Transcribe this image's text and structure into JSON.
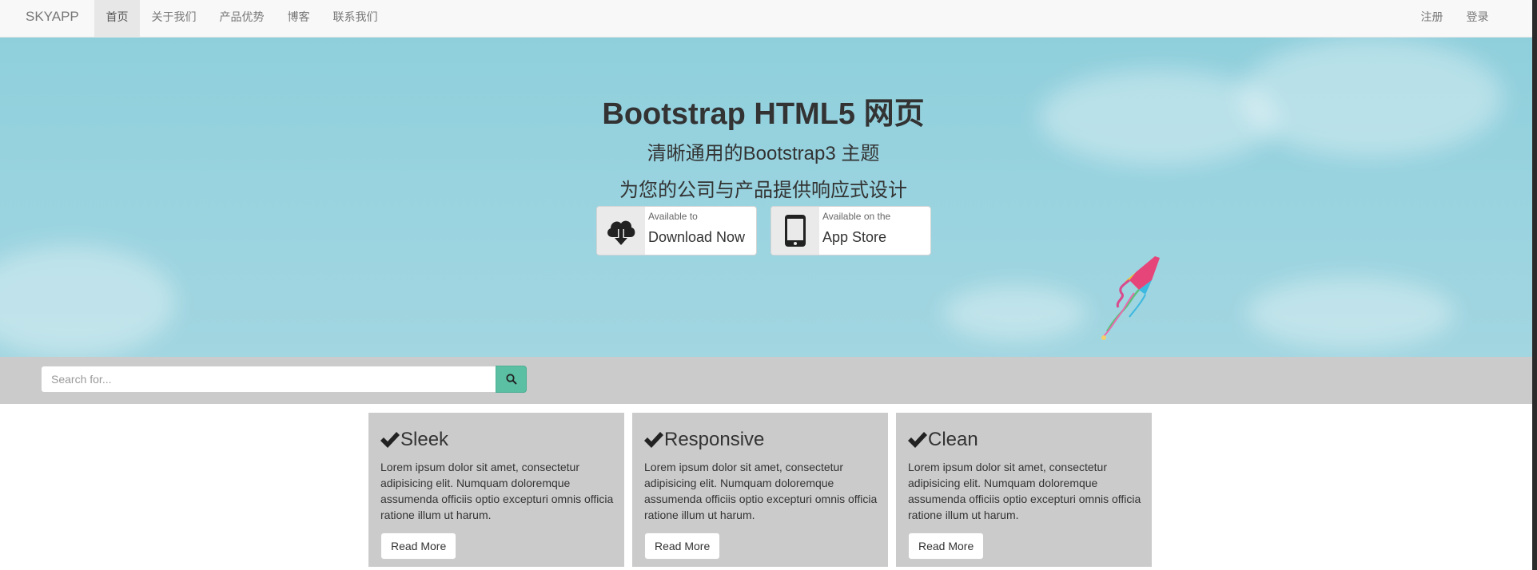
{
  "navbar": {
    "brand": "SKYAPP",
    "items": [
      {
        "label": "首页",
        "active": true
      },
      {
        "label": "关于我们"
      },
      {
        "label": "产品优势"
      },
      {
        "label": "博客"
      },
      {
        "label": "联系我们"
      }
    ],
    "right_items": [
      {
        "label": "注册"
      },
      {
        "label": "登录"
      }
    ]
  },
  "hero": {
    "title": "Bootstrap HTML5 网页",
    "subtitle1": "清晰通用的Bootstrap3 主题",
    "subtitle2": "为您的公司与产品提供响应式设计",
    "buttons": [
      {
        "small": "Available to",
        "big": "Download Now",
        "icon": "cloud-download-icon"
      },
      {
        "small": "Available on the",
        "big": "App Store",
        "icon": "mobile-phone-icon"
      }
    ]
  },
  "search": {
    "placeholder": "Search for...",
    "button_icon": "search-icon",
    "button_color": "#5bc0a3"
  },
  "features": [
    {
      "title": "Sleek",
      "text": "Lorem ipsum dolor sit amet, consectetur adipisicing elit. Numquam doloremque assumenda officiis optio excepturi omnis officia ratione illum ut harum.",
      "button": "Read More"
    },
    {
      "title": "Responsive",
      "text": "Lorem ipsum dolor sit amet, consectetur adipisicing elit. Numquam doloremque assumenda officiis optio excepturi omnis officia ratione illum ut harum.",
      "button": "Read More"
    },
    {
      "title": "Clean",
      "text": "Lorem ipsum dolor sit amet, consectetur adipisicing elit. Numquam doloremque assumenda officiis optio excepturi omnis officia ratione illum ut harum.",
      "button": "Read More"
    }
  ]
}
